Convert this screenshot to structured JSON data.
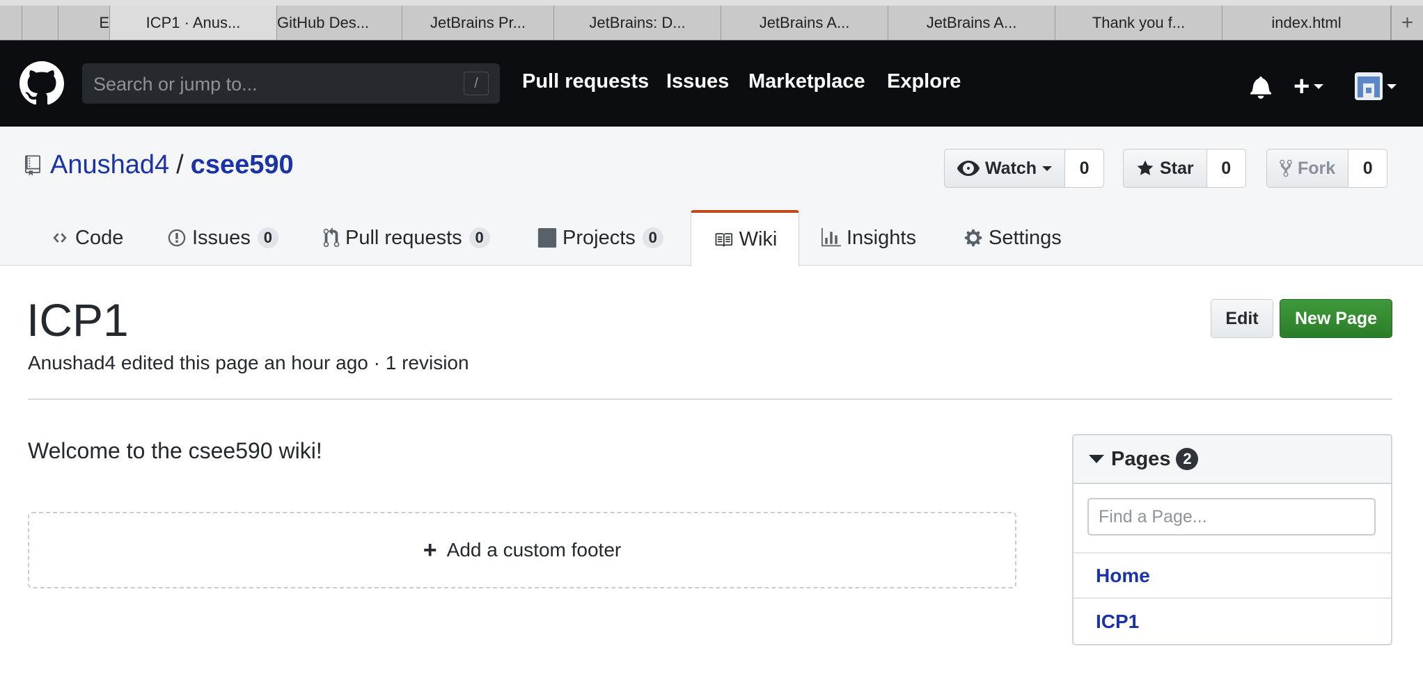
{
  "browser_tabs": [
    {
      "label": ""
    },
    {
      "label": ""
    },
    {
      "label": "E"
    },
    {
      "label": "ICP1 · Anus...",
      "active": true
    },
    {
      "label": "GitHub Des..."
    },
    {
      "label": "JetBrains Pr..."
    },
    {
      "label": "JetBrains: D..."
    },
    {
      "label": "JetBrains A..."
    },
    {
      "label": "JetBrains A..."
    },
    {
      "label": "Thank you f..."
    },
    {
      "label": "index.html"
    }
  ],
  "header": {
    "search_placeholder": "Search or jump to...",
    "search_shortcut": "/",
    "nav": [
      "Pull requests",
      "Issues",
      "Marketplace",
      "Explore"
    ],
    "plus_label": "+"
  },
  "repo": {
    "owner": "Anushad4",
    "separator": "/",
    "name": "csee590",
    "watch": {
      "label": "Watch",
      "count": "0"
    },
    "star": {
      "label": "Star",
      "count": "0"
    },
    "fork": {
      "label": "Fork",
      "count": "0"
    }
  },
  "repo_tabs": {
    "code": "Code",
    "issues": {
      "label": "Issues",
      "count": "0"
    },
    "pulls": {
      "label": "Pull requests",
      "count": "0"
    },
    "projects": {
      "label": "Projects",
      "count": "0"
    },
    "wiki": "Wiki",
    "insights": "Insights",
    "settings": "Settings"
  },
  "wiki": {
    "title": "ICP1",
    "meta": "Anushad4 edited this page an hour ago · 1 revision",
    "edit_label": "Edit",
    "new_page_label": "New Page",
    "body": "Welcome to the csee590 wiki!",
    "custom_footer_label": "Add a custom footer"
  },
  "sidebar": {
    "heading": "Pages",
    "count": "2",
    "find_placeholder": "Find a Page...",
    "pages": [
      "Home",
      "ICP1"
    ]
  },
  "colors": {
    "header_bg": "#0b0d10",
    "link_blue": "#1a33a6",
    "primary_green": "#2f8a2d",
    "wiki_tab_accent": "#c1481d"
  }
}
